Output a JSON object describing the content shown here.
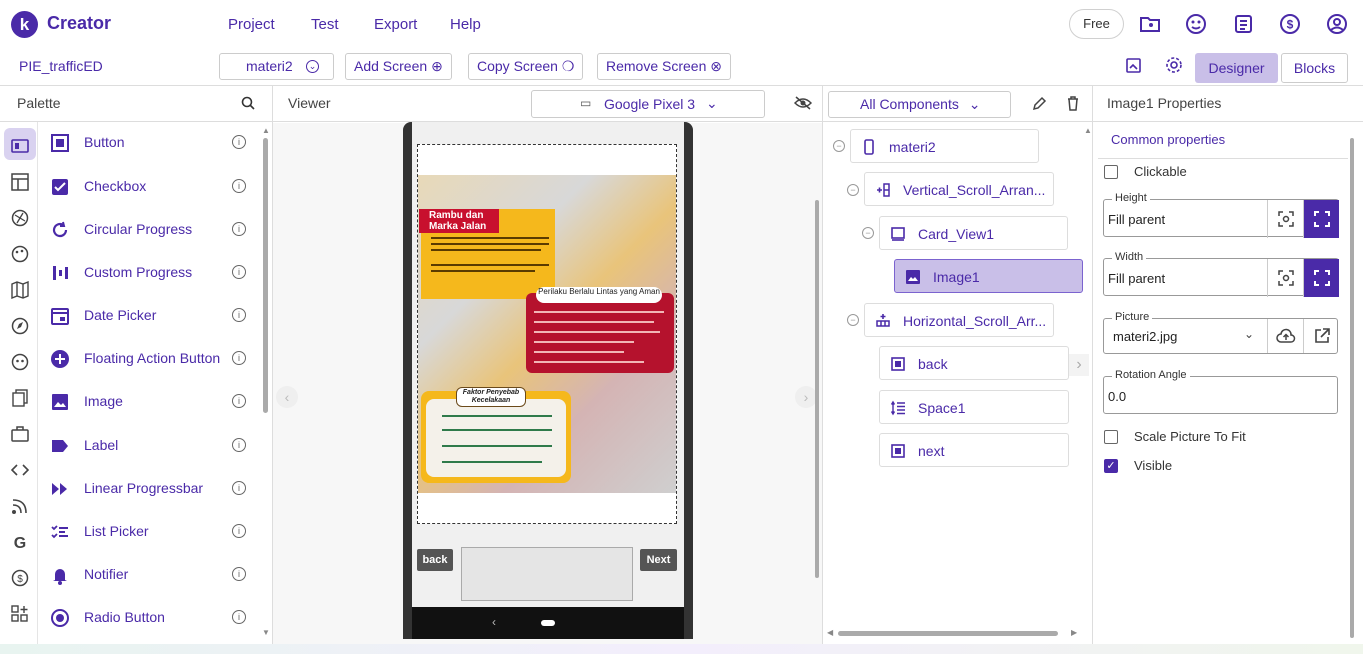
{
  "app": {
    "logo_letter": "k",
    "name": "Creator"
  },
  "menu": [
    "Project",
    "Test",
    "Export",
    "Help"
  ],
  "plan_badge": "Free",
  "toolbar": {
    "project_name": "PIE_trafficED",
    "screen_select": "materi2",
    "add_screen": "Add Screen",
    "copy_screen": "Copy Screen",
    "remove_screen": "Remove Screen",
    "designer_tab": "Designer",
    "blocks_tab": "Blocks"
  },
  "palette": {
    "title": "Palette",
    "items": [
      {
        "label": "Button",
        "icon": "button-icon"
      },
      {
        "label": "Checkbox",
        "icon": "checkbox-icon"
      },
      {
        "label": "Circular Progress",
        "icon": "circular-progress-icon"
      },
      {
        "label": "Custom Progress",
        "icon": "custom-progress-icon"
      },
      {
        "label": "Date Picker",
        "icon": "date-picker-icon"
      },
      {
        "label": "Floating Action Button",
        "icon": "fab-icon"
      },
      {
        "label": "Image",
        "icon": "image-icon"
      },
      {
        "label": "Label",
        "icon": "label-icon"
      },
      {
        "label": "Linear Progressbar",
        "icon": "linear-progress-icon"
      },
      {
        "label": "List Picker",
        "icon": "list-picker-icon"
      },
      {
        "label": "Notifier",
        "icon": "notifier-icon"
      },
      {
        "label": "Radio Button",
        "icon": "radio-button-icon"
      }
    ]
  },
  "viewer": {
    "title": "Viewer",
    "device": "Google Pixel 3",
    "poster_title": "Rambu dan Marka Jalan",
    "poster_box2_title": "Perilaku Berlalu Lintas yang Aman",
    "poster_box3_title": "Faktor Penyebab Kecelakaan",
    "back_label": "back",
    "next_label": "Next"
  },
  "components": {
    "filter": "All Components",
    "tree": [
      {
        "label": "materi2",
        "icon": "phone-icon",
        "depth": 0
      },
      {
        "label": "Vertical_Scroll_Arran...",
        "icon": "vertical-scroll-icon",
        "depth": 1
      },
      {
        "label": "Card_View1",
        "icon": "card-icon",
        "depth": 2
      },
      {
        "label": "Image1",
        "icon": "image-icon",
        "depth": 3,
        "selected": true
      },
      {
        "label": "Horizontal_Scroll_Arr...",
        "icon": "horizontal-scroll-icon",
        "depth": 1
      },
      {
        "label": "back",
        "icon": "button-icon",
        "depth": 2
      },
      {
        "label": "Space1",
        "icon": "space-icon",
        "depth": 2
      },
      {
        "label": "next",
        "icon": "button-icon",
        "depth": 2
      }
    ]
  },
  "properties": {
    "title": "Image1 Properties",
    "section": "Common properties",
    "clickable_label": "Clickable",
    "clickable": false,
    "height_label": "Height",
    "height_value": "Fill parent",
    "width_label": "Width",
    "width_value": "Fill parent",
    "picture_label": "Picture",
    "picture_value": "materi2.jpg",
    "rotation_label": "Rotation Angle",
    "rotation_value": "0.0",
    "scale_label": "Scale Picture To Fit",
    "scale": false,
    "visible_label": "Visible",
    "visible": true
  },
  "colors": {
    "accent": "#4a2aa8",
    "selected": "#c9bfe8"
  }
}
